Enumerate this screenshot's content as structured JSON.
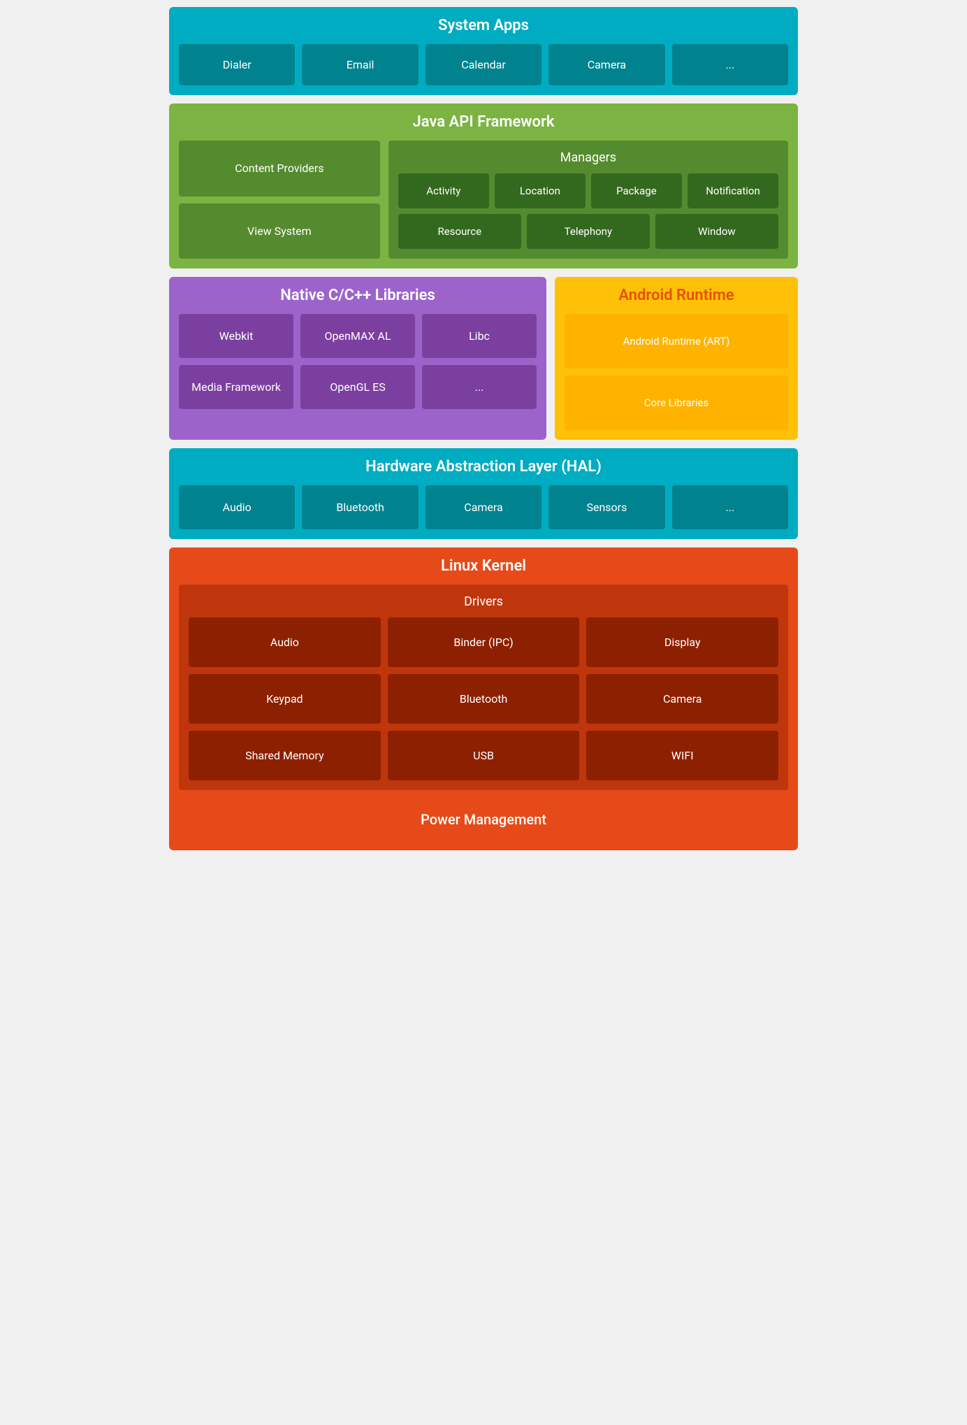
{
  "system_apps": {
    "title": "System Apps",
    "items": [
      "Dialer",
      "Email",
      "Calendar",
      "Camera",
      "..."
    ]
  },
  "java_api": {
    "title": "Java API Framework",
    "left_items": [
      "Content Providers",
      "View System"
    ],
    "managers_title": "Managers",
    "managers_row1": [
      "Activity",
      "Location",
      "Package",
      "Notification"
    ],
    "managers_row2": [
      "Resource",
      "Telephony",
      "Window"
    ]
  },
  "native_libs": {
    "title": "Native C/C++ Libraries",
    "row1": [
      "Webkit",
      "OpenMAX AL",
      "Libc"
    ],
    "row2": [
      "Media Framework",
      "OpenGL ES",
      "..."
    ]
  },
  "android_runtime": {
    "title": "Android Runtime",
    "items": [
      "Android Runtime (ART)",
      "Core Libraries"
    ]
  },
  "hal": {
    "title": "Hardware Abstraction Layer (HAL)",
    "items": [
      "Audio",
      "Bluetooth",
      "Camera",
      "Sensors",
      "..."
    ]
  },
  "linux_kernel": {
    "title": "Linux Kernel",
    "drivers_title": "Drivers",
    "drivers_row1": [
      "Audio",
      "Binder (IPC)",
      "Display"
    ],
    "drivers_row2": [
      "Keypad",
      "Bluetooth",
      "Camera"
    ],
    "drivers_row3": [
      "Shared Memory",
      "USB",
      "WIFI"
    ],
    "power_management": "Power Management"
  }
}
